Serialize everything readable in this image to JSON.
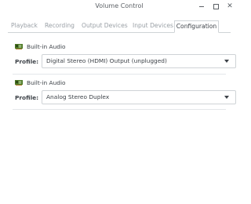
{
  "window": {
    "title": "Volume Control",
    "controls": {
      "minimize": "minimize-icon",
      "maximize": "maximize-icon",
      "close": "close-icon"
    }
  },
  "tabs": [
    {
      "label": "Playback",
      "active": false
    },
    {
      "label": "Recording",
      "active": false
    },
    {
      "label": "Output Devices",
      "active": false
    },
    {
      "label": "Input Devices",
      "active": false
    },
    {
      "label": "Configuration",
      "active": true
    }
  ],
  "cards": [
    {
      "icon": "audio-card-icon",
      "title": "Built-in Audio",
      "profile_label": "Profile:",
      "profile_value": "Digital Stereo (HDMI) Output (unplugged)"
    },
    {
      "icon": "audio-card-icon",
      "title": "Built-in Audio",
      "profile_label": "Profile:",
      "profile_value": "Analog Stereo Duplex"
    }
  ],
  "colors": {
    "text": "#3d4248",
    "muted_text": "#9aa0a6",
    "border": "#cfd3d6",
    "icon_green": "#4e7a27"
  }
}
